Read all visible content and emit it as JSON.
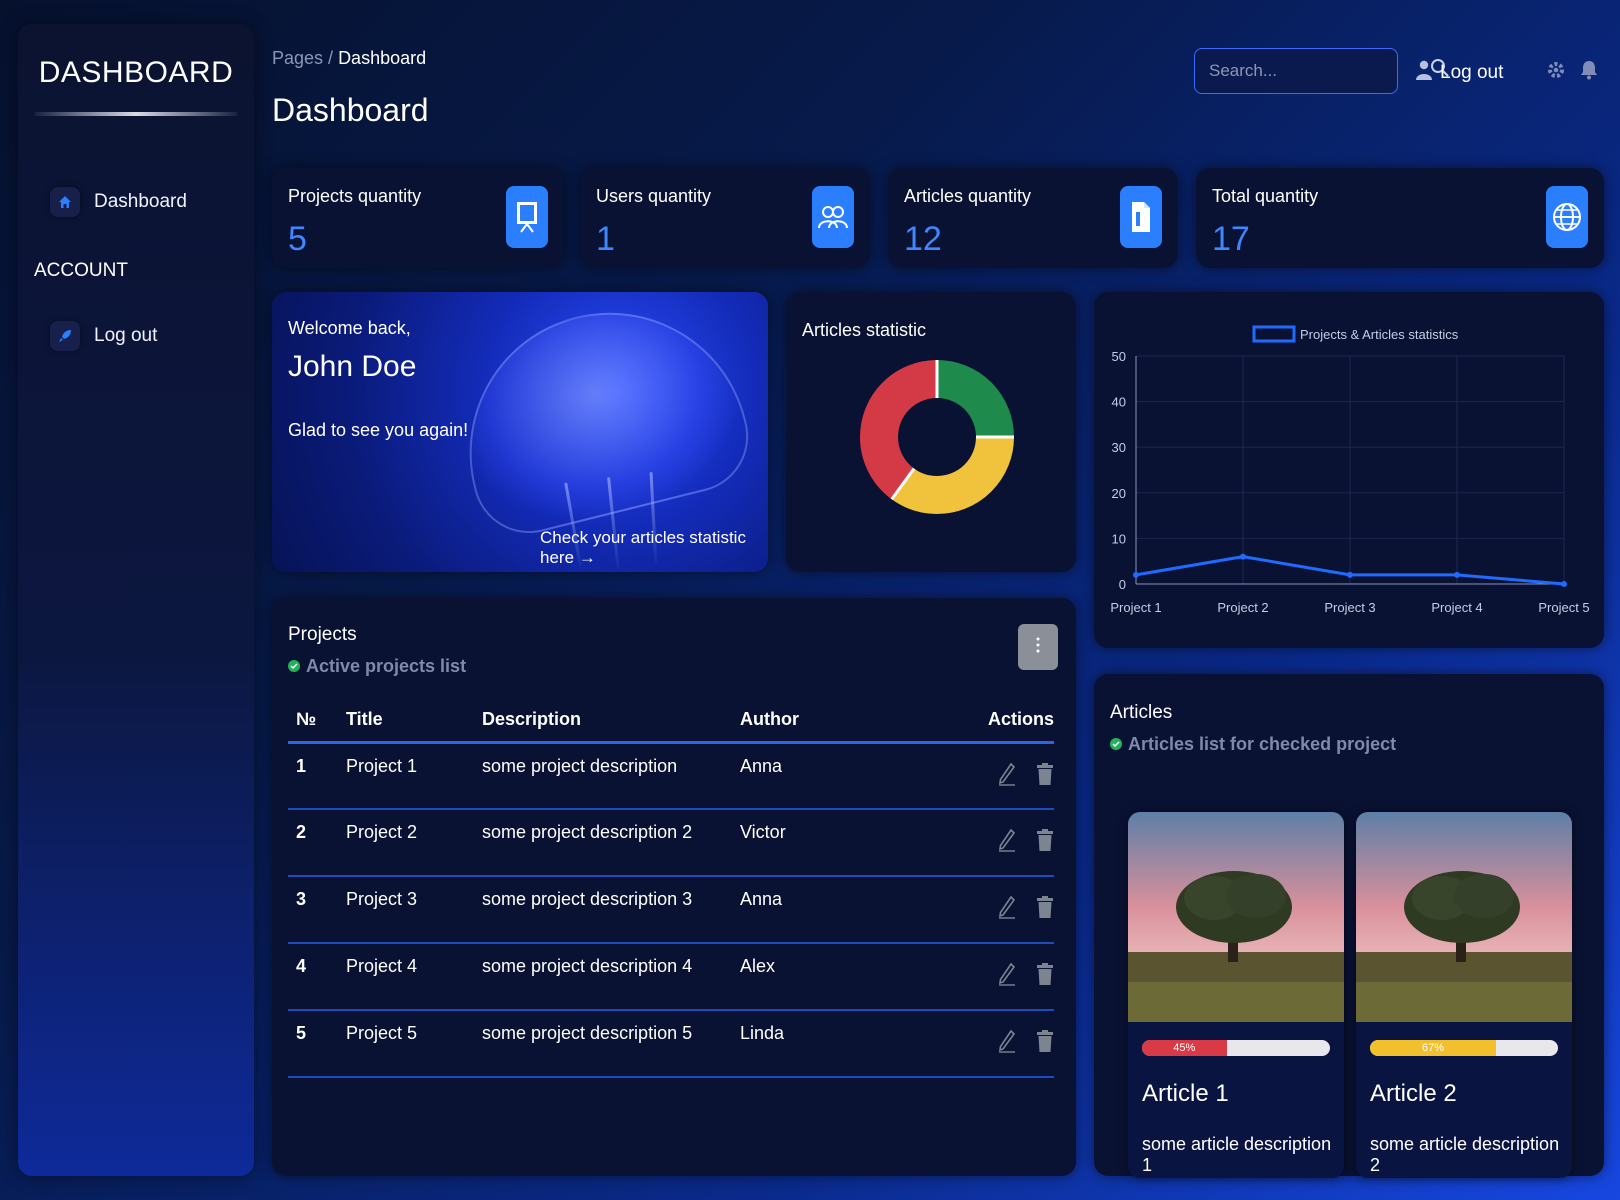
{
  "sidebar": {
    "brand": "DASHBOARD",
    "items": [
      {
        "label": "Dashboard",
        "icon": "home-icon"
      }
    ],
    "account_title": "ACCOUNT",
    "account_items": [
      {
        "label": "Log out",
        "icon": "rocket-icon"
      }
    ]
  },
  "header": {
    "breadcrumb_root": "Pages",
    "breadcrumb_sep": " / ",
    "breadcrumb_current": "Dashboard",
    "title": "Dashboard",
    "search_placeholder": "Search...",
    "logout_label": "Log out"
  },
  "stats": [
    {
      "label": "Projects quantity",
      "value": "5",
      "icon": "presentation-icon"
    },
    {
      "label": "Users quantity",
      "value": "1",
      "icon": "users-icon"
    },
    {
      "label": "Articles quantity",
      "value": "12",
      "icon": "document-icon"
    },
    {
      "label": "Total quantity",
      "value": "17",
      "icon": "globe-icon"
    }
  ],
  "welcome": {
    "greeting": "Welcome back,",
    "name": "John Doe",
    "message": "Glad to see you again!",
    "link": "Check your articles statistic here →"
  },
  "articles_statistic": {
    "title": "Articles statistic"
  },
  "chart_data": [
    {
      "type": "pie",
      "title": "Articles statistic",
      "donut": true,
      "slices": [
        {
          "value": 25,
          "color": "#1e8a4c"
        },
        {
          "value": 35,
          "color": "#f1c33d"
        },
        {
          "value": 40,
          "color": "#d33a45"
        }
      ]
    },
    {
      "type": "line",
      "title": "",
      "legend": "Projects & Articles statistics",
      "legend_position": "top-center",
      "categories": [
        "Project 1",
        "Project 2",
        "Project 3",
        "Project 4",
        "Project 5"
      ],
      "series": [
        {
          "name": "Projects & Articles statistics",
          "values": [
            2,
            6,
            2,
            2,
            0
          ],
          "color": "#1f6bff"
        }
      ],
      "yticks": [
        0,
        10,
        20,
        30,
        40,
        50
      ],
      "ylim": [
        0,
        50
      ],
      "grid": true
    }
  ],
  "projects": {
    "title": "Projects",
    "subtitle": "Active projects list",
    "columns": [
      "№",
      "Title",
      "Description",
      "Author",
      "Actions"
    ],
    "rows": [
      {
        "num": "1",
        "title": "Project 1",
        "description": "some project description",
        "author": "Anna"
      },
      {
        "num": "2",
        "title": "Project 2",
        "description": "some project description 2",
        "author": "Victor"
      },
      {
        "num": "3",
        "title": "Project 3",
        "description": "some project description 3",
        "author": "Anna"
      },
      {
        "num": "4",
        "title": "Project 4",
        "description": "some project description 4",
        "author": "Alex"
      },
      {
        "num": "5",
        "title": "Project 5",
        "description": "some project description 5",
        "author": "Linda"
      }
    ]
  },
  "articles": {
    "title": "Articles",
    "subtitle": "Articles list for checked project",
    "items": [
      {
        "title": "Article 1",
        "description": "some article description 1",
        "progress": 45,
        "progress_label": "45%",
        "color": "#d93a45"
      },
      {
        "title": "Article 2",
        "description": "some article description 2",
        "progress": 67,
        "progress_label": "67%",
        "color": "#f1c02c"
      }
    ]
  }
}
